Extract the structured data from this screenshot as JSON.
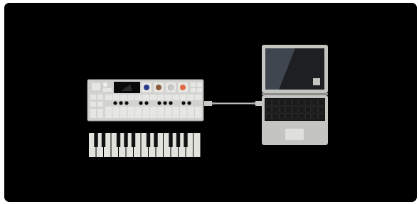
{
  "colors": {
    "background": "#000000",
    "device_body": "#d2d3d0",
    "device_edge": "#9fa09c",
    "key_light": "#e6e7e3",
    "display": "#0a0a0a",
    "knob_blue": "#2a3a8c",
    "knob_brown": "#8a5a3a",
    "knob_grey": "#c8c8c4",
    "knob_orange": "#e06a40",
    "laptop_body": "#c4c5c1",
    "laptop_screen": "#1e1f22",
    "laptop_glare": "#3f464f",
    "keyboard_keys": "#111111",
    "piano_white": "#e2e3dd",
    "piano_black": "#111111",
    "cable": "#c9cac6"
  },
  "icons": [
    "synthesizer-icon",
    "piano-keyboard-icon",
    "usb-cable-icon",
    "laptop-icon"
  ]
}
